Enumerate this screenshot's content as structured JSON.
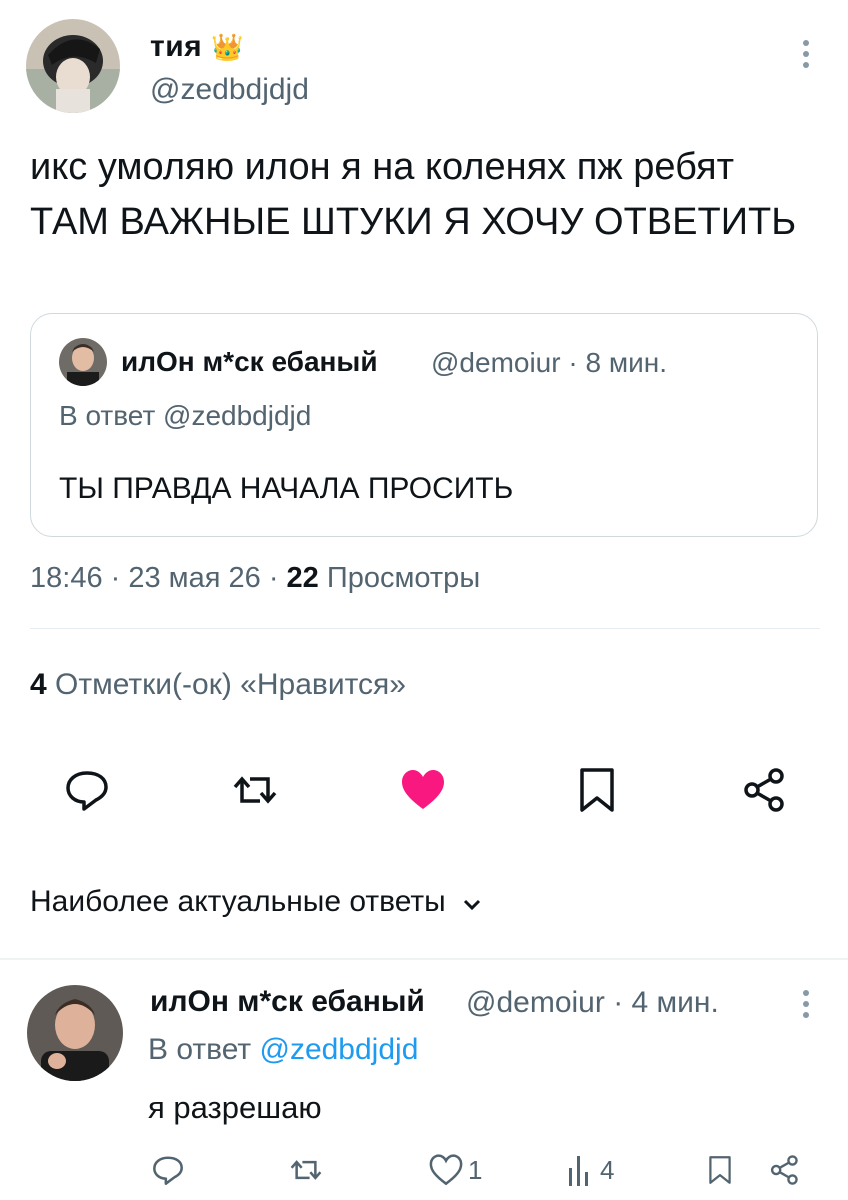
{
  "tweet": {
    "author_name": "тия",
    "author_badge": "👑",
    "author_handle": "@zedbdjdjd",
    "text": "икс умоляю илон я на коленях пж ребят ТАМ ВАЖНЫЕ ШТУКИ Я ХОЧУ ОТВЕТИТЬ",
    "time": "18:46",
    "date": "23 мая 26",
    "views_count": "22",
    "views_label": "Просмотры",
    "likes_count": "4",
    "likes_label": "Отметки(-ок) «Нравится»"
  },
  "quote": {
    "author_name": "илОн м*ск ебаный",
    "author_handle": "@demoiur",
    "age": "8 мин.",
    "reply_to": "В ответ @zedbdjdjd",
    "text": "ТЫ ПРАВДА НАЧАЛА ПРОСИТЬ"
  },
  "actions": {
    "icons": [
      "reply-icon",
      "retweet-icon",
      "like-icon",
      "bookmark-icon",
      "share-icon"
    ],
    "like_color": "#f91880"
  },
  "replies_section": {
    "sort_label": "Наиболее актуальные ответы"
  },
  "reply": {
    "author_name": "илОн м*ск ебаный",
    "author_handle": "@demoiur",
    "age": "4 мин.",
    "reply_prefix": "В ответ",
    "reply_to": "@zedbdjdjd",
    "text": "я разрешаю",
    "like_count": "1",
    "view_count": "4"
  }
}
